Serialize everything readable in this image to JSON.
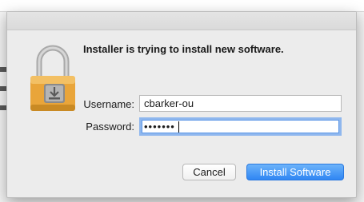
{
  "dialog": {
    "heading": "Installer is trying to install new software."
  },
  "form": {
    "username_label": "Username:",
    "username_value": "cbarker-ou",
    "password_label": "Password:",
    "password_masked": "•••••••"
  },
  "buttons": {
    "cancel_label": "Cancel",
    "install_label": "Install Software"
  },
  "icons": {
    "lock": "lock-icon"
  },
  "colors": {
    "accent": "#2f86f3",
    "focus_ring": "#8fb7ee",
    "lock_body": "#e9a53a",
    "dialog_bg": "#ececec"
  }
}
